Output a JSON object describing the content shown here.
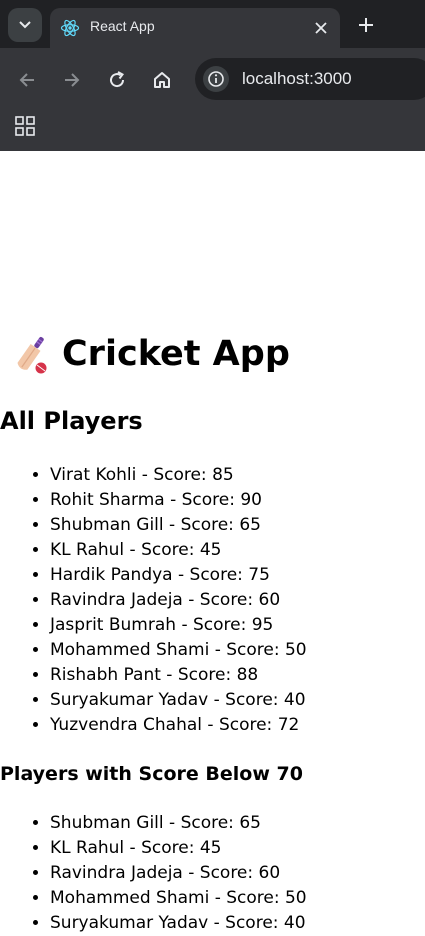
{
  "browser": {
    "tab_title": "React App",
    "url": "localhost:3000",
    "colors": {
      "frame": "#202124",
      "toolbar": "#35363a",
      "text": "#e8eaed"
    },
    "icons": [
      "tab-search-icon",
      "react-favicon-icon",
      "close-icon",
      "plus-icon",
      "back-icon",
      "forward-icon",
      "reload-icon",
      "home-icon",
      "info-icon",
      "apps-icon"
    ]
  },
  "app": {
    "title": "Cricket App",
    "title_icon": "cricket-bat-icon",
    "all_players_heading": "All Players",
    "all_players": [
      "Virat Kohli - Score: 85",
      "Rohit Sharma - Score: 90",
      "Shubman Gill - Score: 65",
      "KL Rahul - Score: 45",
      "Hardik Pandya - Score: 75",
      "Ravindra Jadeja - Score: 60",
      "Jasprit Bumrah - Score: 95",
      "Mohammed Shami - Score: 50",
      "Rishabh Pant - Score: 88",
      "Suryakumar Yadav - Score: 40",
      "Yuzvendra Chahal - Score: 72"
    ],
    "below_heading": "Players with Score Below 70",
    "below_players": [
      "Shubman Gill - Score: 65",
      "KL Rahul - Score: 45",
      "Ravindra Jadeja - Score: 60",
      "Mohammed Shami - Score: 50",
      "Suryakumar Yadav - Score: 40"
    ]
  }
}
